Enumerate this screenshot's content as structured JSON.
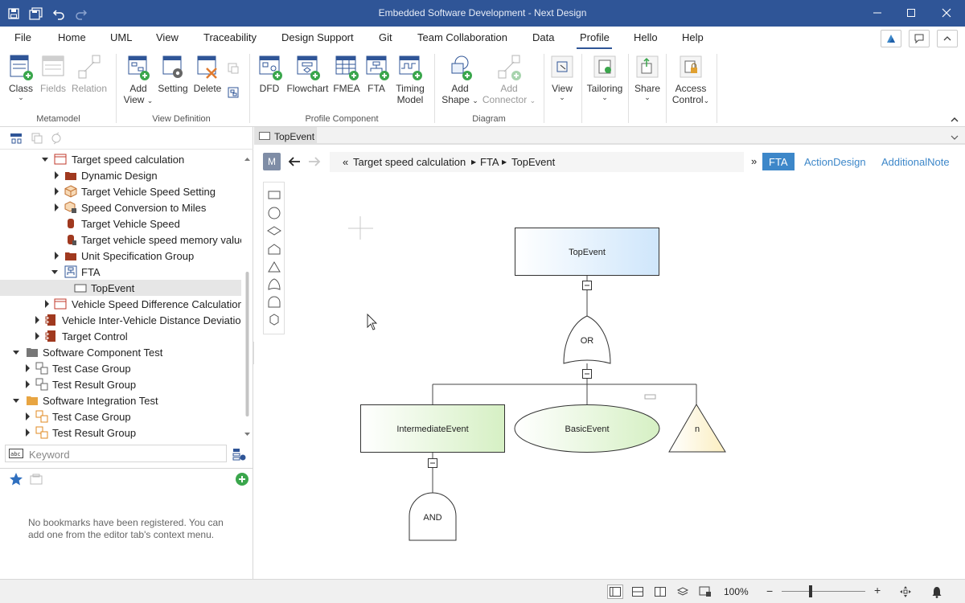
{
  "window": {
    "title": "Embedded Software Development - Next Design"
  },
  "menu": {
    "items": [
      "File",
      "Home",
      "UML",
      "View",
      "Traceability",
      "Design Support",
      "Git",
      "Team Collaboration",
      "Data",
      "Profile",
      "Hello",
      "Help"
    ],
    "active": "Profile"
  },
  "ribbon": {
    "groups": [
      {
        "label": "Metamodel",
        "buttons": [
          "Class",
          "Fields",
          "Relation"
        ]
      },
      {
        "label": "View Definition",
        "buttons": [
          "Add View",
          "Setting",
          "Delete"
        ]
      },
      {
        "label": "Profile Component",
        "buttons": [
          "DFD",
          "Flowchart",
          "FMEA",
          "FTA",
          "Timing Model"
        ]
      },
      {
        "label": "Diagram",
        "buttons": [
          "Add Shape",
          "Add Connector"
        ]
      },
      {
        "label": "",
        "buttons": [
          "View",
          "Tailoring",
          "Share",
          "Access Control"
        ]
      }
    ],
    "labels": {
      "class": "Class",
      "fields": "Fields",
      "relation": "Relation",
      "add_view_1": "Add",
      "add_view_2": "View",
      "setting": "Setting",
      "delete": "Delete",
      "dfd": "DFD",
      "flowchart": "Flowchart",
      "fmea": "FMEA",
      "fta": "FTA",
      "timing_1": "Timing",
      "timing_2": "Model",
      "add_shape_1": "Add",
      "add_shape_2": "Shape",
      "add_conn_1": "Add",
      "add_conn_2": "Connector",
      "view": "View",
      "tailoring": "Tailoring",
      "share": "Share",
      "access_1": "Access",
      "access_2": "Control",
      "g_metamodel": "Metamodel",
      "g_viewdef": "View Definition",
      "g_profile": "Profile Component",
      "g_diagram": "Diagram"
    }
  },
  "tree": {
    "items": [
      {
        "label": "Target speed calculation"
      },
      {
        "label": "Dynamic Design"
      },
      {
        "label": "Target Vehicle Speed Setting"
      },
      {
        "label": "Speed Conversion to Miles"
      },
      {
        "label": "Target Vehicle Speed"
      },
      {
        "label": "Target vehicle speed memory value"
      },
      {
        "label": "Unit Specification Group"
      },
      {
        "label": "FTA"
      },
      {
        "label": "TopEvent"
      },
      {
        "label": "Vehicle Speed Difference Calculation"
      },
      {
        "label": "Vehicle Inter-Vehicle Distance Deviation"
      },
      {
        "label": "Target Control"
      },
      {
        "label": "Software Component Test"
      },
      {
        "label": "Test Case Group"
      },
      {
        "label": "Test Result Group"
      },
      {
        "label": "Software Integration Test"
      },
      {
        "label": "Test Case Group"
      },
      {
        "label": "Test Result Group"
      }
    ]
  },
  "search": {
    "placeholder": "Keyword"
  },
  "bookmarks": {
    "empty_message": "No bookmarks have been registered. You can add one from the editor tab's context menu."
  },
  "editor": {
    "tab_label": "TopEvent",
    "mode_badge": "M",
    "breadcrumb": [
      "Target speed calculation",
      "FTA",
      "TopEvent"
    ],
    "crumb_open": "«",
    "crumb_more": "»",
    "view_tabs": [
      "FTA",
      "ActionDesign",
      "AdditionalNote"
    ],
    "active_view": "FTA"
  },
  "diagram": {
    "nodes": {
      "top": "TopEvent",
      "or_gate": "OR",
      "intermediate": "IntermediateEvent",
      "basic": "BasicEvent",
      "transfer": "n",
      "and_gate": "AND"
    }
  },
  "status": {
    "zoom": "100%",
    "minus": "−",
    "plus": "+",
    "zoom_level": 0.35
  },
  "colors": {
    "titlebar": "#2f5597",
    "accent": "#3d87c9",
    "green_add": "#3aa64c"
  }
}
